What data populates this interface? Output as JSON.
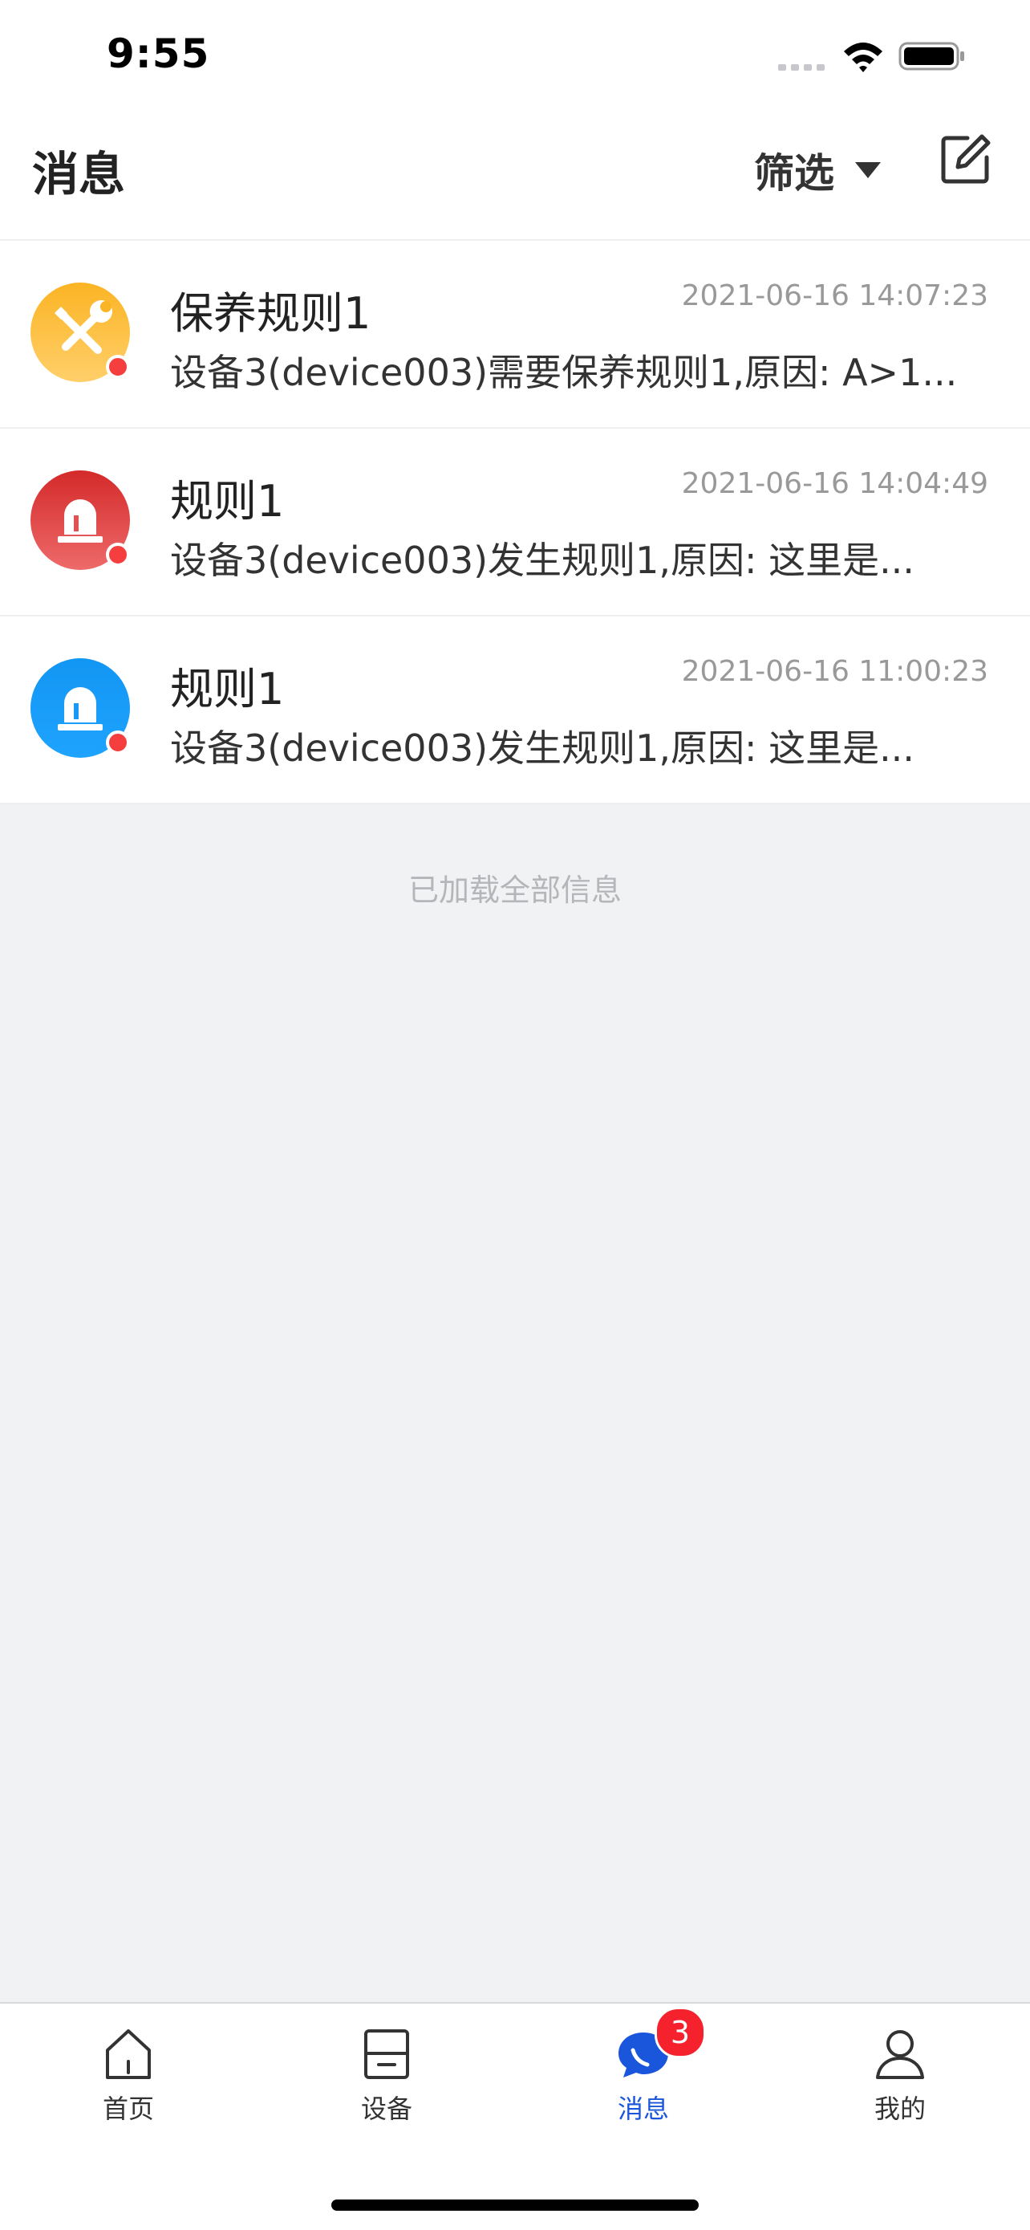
{
  "status_bar": {
    "time": "9:55"
  },
  "header": {
    "title": "消息",
    "filter_label": "筛选"
  },
  "messages": [
    {
      "title": "保养规则1",
      "time": "2021-06-16 14:07:23",
      "body": "设备3(device003)需要保养规则1,原因: A>1...",
      "icon": "wrench-screwdriver-icon",
      "color": "#fbb424"
    },
    {
      "title": "规则1",
      "time": "2021-06-16 14:04:49",
      "body": "设备3(device003)发生规则1,原因: 这里是...",
      "icon": "alarm-light-icon",
      "color": "#d42a2a"
    },
    {
      "title": "规则1",
      "time": "2021-06-16 11:00:23",
      "body": "设备3(device003)发生规则1,原因: 这里是...",
      "icon": "alarm-light-icon",
      "color": "#1296f3"
    }
  ],
  "list_footer": "已加载全部信息",
  "tabs": [
    {
      "label": "首页",
      "icon": "home-icon"
    },
    {
      "label": "设备",
      "icon": "device-icon"
    },
    {
      "label": "消息",
      "icon": "chat-bubble-icon",
      "badge": "3"
    },
    {
      "label": "我的",
      "icon": "user-icon"
    }
  ],
  "colors": {
    "accent": "#1a56db",
    "badge": "#f5222d",
    "unread": "#f53f3f"
  }
}
